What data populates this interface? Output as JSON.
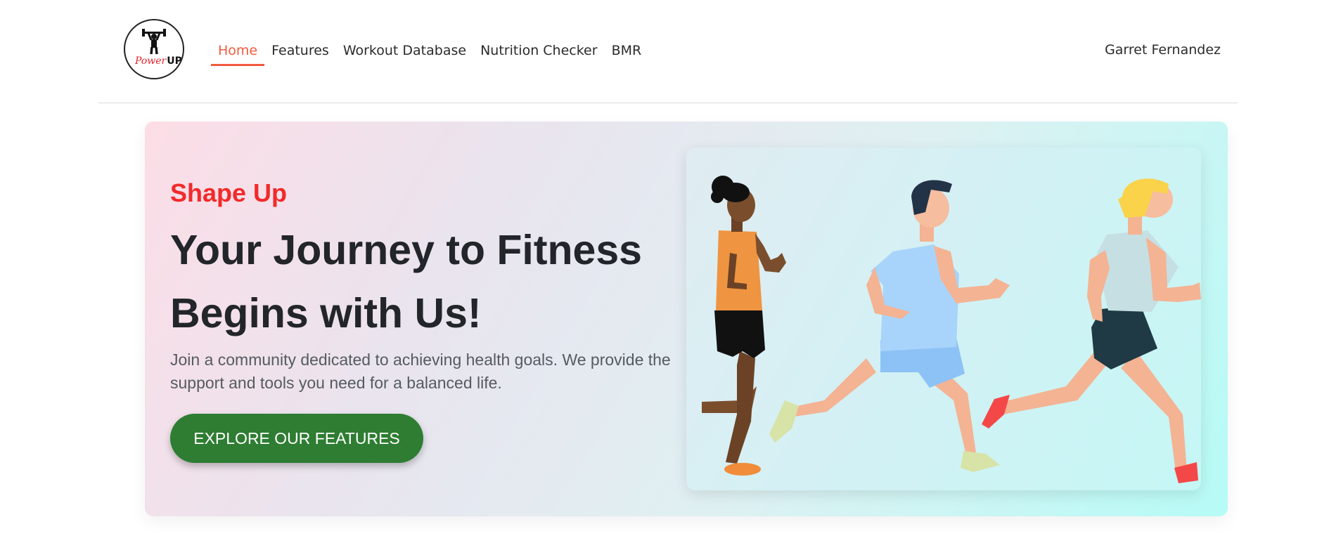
{
  "brand": {
    "logo_text_script": "Power",
    "logo_text_bold": "UP"
  },
  "nav": {
    "items": [
      {
        "label": "Home",
        "active": true
      },
      {
        "label": "Features",
        "active": false
      },
      {
        "label": "Workout Database",
        "active": false
      },
      {
        "label": "Nutrition Checker",
        "active": false
      },
      {
        "label": "BMR",
        "active": false
      }
    ]
  },
  "user": {
    "name": "Garret Fernandez"
  },
  "hero": {
    "eyebrow": "Shape Up",
    "headline": "Your Journey to Fitness Begins with Us!",
    "description": "Join a community dedicated to achieving health goals. We provide the support and tools you need for a balanced life.",
    "cta_label": "EXPLORE OUR FEATURES",
    "illustration": "runners-illustration"
  },
  "colors": {
    "accent": "#f25a3e",
    "eyebrow": "#f22a2a",
    "cta": "#2e7d32"
  }
}
